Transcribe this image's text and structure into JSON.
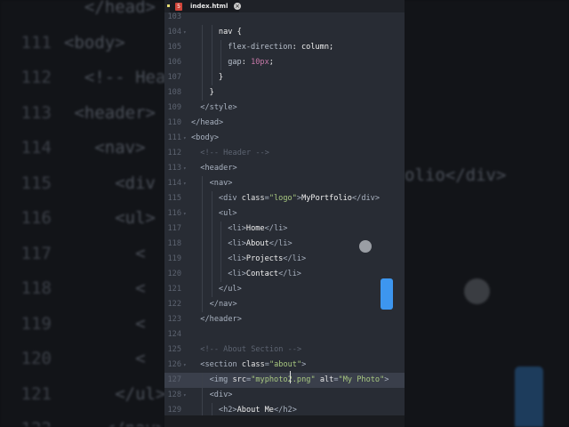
{
  "tab": {
    "filename": "index.html",
    "file_icon": "html5-icon",
    "close_icon": "close-icon"
  },
  "background": {
    "lines": [
      {
        "n": "",
        "t": "  </head>"
      },
      {
        "n": "111",
        "t": "<body>"
      },
      {
        "n": "112",
        "t": "  <!-- Hea"
      },
      {
        "n": "113",
        "t": " <header>"
      },
      {
        "n": "114",
        "t": "   <nav>"
      },
      {
        "n": "115",
        "t": "     <div"
      },
      {
        "n": "116",
        "t": "     <ul>"
      },
      {
        "n": "117",
        "t": "       <"
      },
      {
        "n": "118",
        "t": "       <"
      },
      {
        "n": "119",
        "t": "       <"
      },
      {
        "n": "120",
        "t": "       <"
      },
      {
        "n": "121",
        "t": "     </ul>"
      },
      {
        "n": "122",
        "t": "    </nav>"
      }
    ],
    "right_text": "olio</div>"
  },
  "code": [
    {
      "n": "103",
      "i": 0,
      "tok": []
    },
    {
      "n": "104",
      "i": 3,
      "f": true,
      "tok": [
        [
          "txt",
          "nav {"
        ]
      ]
    },
    {
      "n": "105",
      "i": 4,
      "tok": [
        [
          "prop",
          "flex-direction"
        ],
        [
          "txt",
          ": column;"
        ]
      ]
    },
    {
      "n": "106",
      "i": 4,
      "tok": [
        [
          "prop",
          "gap"
        ],
        [
          "txt",
          ": "
        ],
        [
          "num",
          "10px"
        ],
        [
          "txt",
          ";"
        ]
      ]
    },
    {
      "n": "107",
      "i": 3,
      "tok": [
        [
          "txt",
          "}"
        ]
      ]
    },
    {
      "n": "108",
      "i": 2,
      "tok": [
        [
          "txt",
          "}"
        ]
      ]
    },
    {
      "n": "109",
      "i": 1,
      "tok": [
        [
          "tag",
          "</style>"
        ]
      ]
    },
    {
      "n": "110",
      "i": 0,
      "tok": [
        [
          "tag",
          "</head>"
        ]
      ]
    },
    {
      "n": "111",
      "i": 0,
      "f": true,
      "tok": [
        [
          "tag",
          "<body>"
        ]
      ]
    },
    {
      "n": "112",
      "i": 1,
      "tok": [
        [
          "com",
          "<!-- Header -->"
        ]
      ]
    },
    {
      "n": "113",
      "i": 1,
      "f": true,
      "tok": [
        [
          "tag",
          "<header>"
        ]
      ]
    },
    {
      "n": "114",
      "i": 2,
      "f": true,
      "tok": [
        [
          "tag",
          "<nav>"
        ]
      ]
    },
    {
      "n": "115",
      "i": 3,
      "tok": [
        [
          "tag",
          "<div "
        ],
        [
          "attr",
          "class"
        ],
        [
          "tag",
          "="
        ],
        [
          "str",
          "\"logo\""
        ],
        [
          "tag",
          ">"
        ],
        [
          "txt",
          "MyPortfolio"
        ],
        [
          "tag",
          "</div>"
        ]
      ]
    },
    {
      "n": "116",
      "i": 3,
      "f": true,
      "tok": [
        [
          "tag",
          "<ul>"
        ]
      ]
    },
    {
      "n": "117",
      "i": 4,
      "tok": [
        [
          "tag",
          "<li>"
        ],
        [
          "txt",
          "Home"
        ],
        [
          "tag",
          "</li>"
        ]
      ]
    },
    {
      "n": "118",
      "i": 4,
      "tok": [
        [
          "tag",
          "<li>"
        ],
        [
          "txt",
          "About"
        ],
        [
          "tag",
          "</li>"
        ]
      ]
    },
    {
      "n": "119",
      "i": 4,
      "tok": [
        [
          "tag",
          "<li>"
        ],
        [
          "txt",
          "Projects"
        ],
        [
          "tag",
          "</li>"
        ]
      ]
    },
    {
      "n": "120",
      "i": 4,
      "tok": [
        [
          "tag",
          "<li>"
        ],
        [
          "txt",
          "Contact"
        ],
        [
          "tag",
          "</li>"
        ]
      ]
    },
    {
      "n": "121",
      "i": 3,
      "tok": [
        [
          "tag",
          "</ul>"
        ]
      ]
    },
    {
      "n": "122",
      "i": 2,
      "tok": [
        [
          "tag",
          "</nav>"
        ]
      ]
    },
    {
      "n": "123",
      "i": 1,
      "tok": [
        [
          "tag",
          "</header>"
        ]
      ]
    },
    {
      "n": "124",
      "i": 0,
      "tok": []
    },
    {
      "n": "125",
      "i": 1,
      "tok": [
        [
          "com",
          "<!-- About Section -->"
        ]
      ]
    },
    {
      "n": "126",
      "i": 1,
      "f": true,
      "tok": [
        [
          "tag",
          "<section "
        ],
        [
          "attr",
          "class"
        ],
        [
          "tag",
          "="
        ],
        [
          "str",
          "\"about\""
        ],
        [
          "tag",
          ">"
        ]
      ]
    },
    {
      "n": "127",
      "i": 2,
      "hl": true,
      "tok": [
        [
          "tag",
          "<img "
        ],
        [
          "attr",
          "src"
        ],
        [
          "tag",
          "="
        ],
        [
          "str",
          "\"myphoto2.png\""
        ],
        [
          "txt",
          " "
        ],
        [
          "attr",
          "alt"
        ],
        [
          "tag",
          "="
        ],
        [
          "str",
          "\"My Photo\""
        ],
        [
          "tag",
          ">"
        ]
      ]
    },
    {
      "n": "128",
      "i": 2,
      "f": true,
      "tok": [
        [
          "tag",
          "<div>"
        ]
      ]
    },
    {
      "n": "129",
      "i": 3,
      "tok": [
        [
          "tag",
          "<h2>"
        ],
        [
          "txt",
          "About Me"
        ],
        [
          "tag",
          "</h2>"
        ]
      ]
    }
  ],
  "colors": {
    "editor_bg": "#282c34",
    "accent": "#3d96ef",
    "string": "#a8c880"
  }
}
